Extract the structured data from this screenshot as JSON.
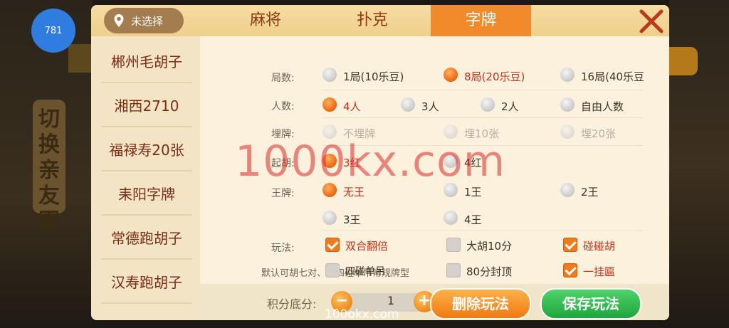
{
  "badge": "781",
  "location": "未选择",
  "tabs": [
    "麻将",
    "扑克",
    "字牌"
  ],
  "active_tab": "字牌",
  "background_side_text": "切换亲友圈",
  "sidebar": [
    "郴州毛胡子",
    "湘西2710",
    "福禄寿20张",
    "耒阳字牌",
    "常德跑胡子",
    "汉寿跑胡子"
  ],
  "settings": {
    "rounds": {
      "label": "局数:",
      "options": [
        "1局(10乐豆)",
        "8局(20乐豆)",
        "16局(40乐豆"
      ]
    },
    "players": {
      "label": "人数:",
      "options": [
        "4人",
        "3人",
        "2人",
        "自由人数"
      ]
    },
    "bury": {
      "label": "埋牌:",
      "options": [
        "不埋牌",
        "埋10张",
        "埋20张"
      ]
    },
    "start": {
      "label": "起胡:",
      "options": [
        "3红",
        "4红"
      ]
    },
    "king": {
      "label": "王牌:",
      "options": [
        "无王",
        "1王",
        "2王",
        "3王",
        "4王"
      ]
    },
    "play": {
      "label": "玩法:",
      "options": [
        "双合翻倍",
        "大胡10分",
        "碰碰胡"
      ]
    },
    "default_text": "默认可胡七对、大四碰单吊常规牌型",
    "extra": [
      "四碰单吊",
      "80分封顶",
      "一挂匾"
    ]
  },
  "footer": {
    "score_label": "积分底分:",
    "minus": "−",
    "plus": "+",
    "value": "1",
    "delete": "删除玩法",
    "save": "保存玩法"
  },
  "watermark": "1000kx.com",
  "watermark_small": "100okx.com",
  "colors": {
    "accent": "#f08a2a",
    "selected": "#d12f1a",
    "save": "#1ea53c"
  }
}
